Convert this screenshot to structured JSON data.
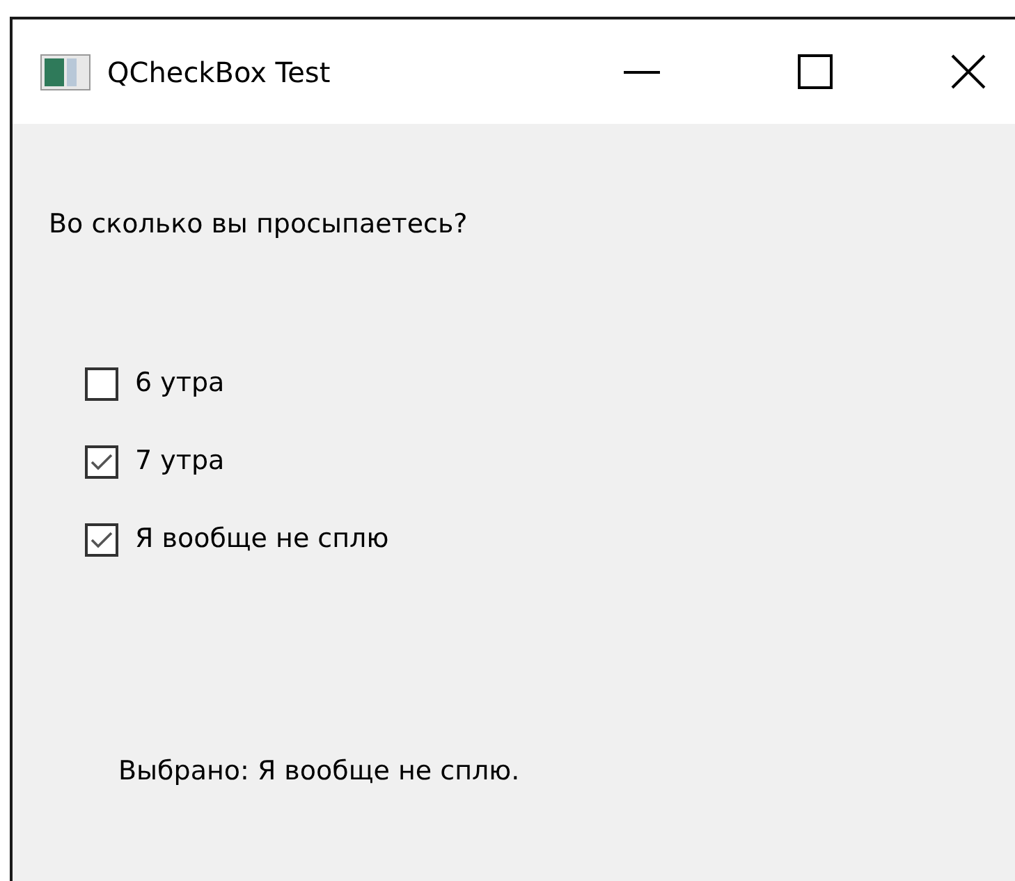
{
  "window": {
    "title": "QCheckBox Test"
  },
  "question": "Во сколько вы просыпаетесь?",
  "options": [
    {
      "label": "6 утра",
      "checked": false
    },
    {
      "label": "7 утра",
      "checked": true
    },
    {
      "label": "Я вообще не сплю",
      "checked": true
    }
  ],
  "result": "Выбрано: Я вообще не сплю."
}
